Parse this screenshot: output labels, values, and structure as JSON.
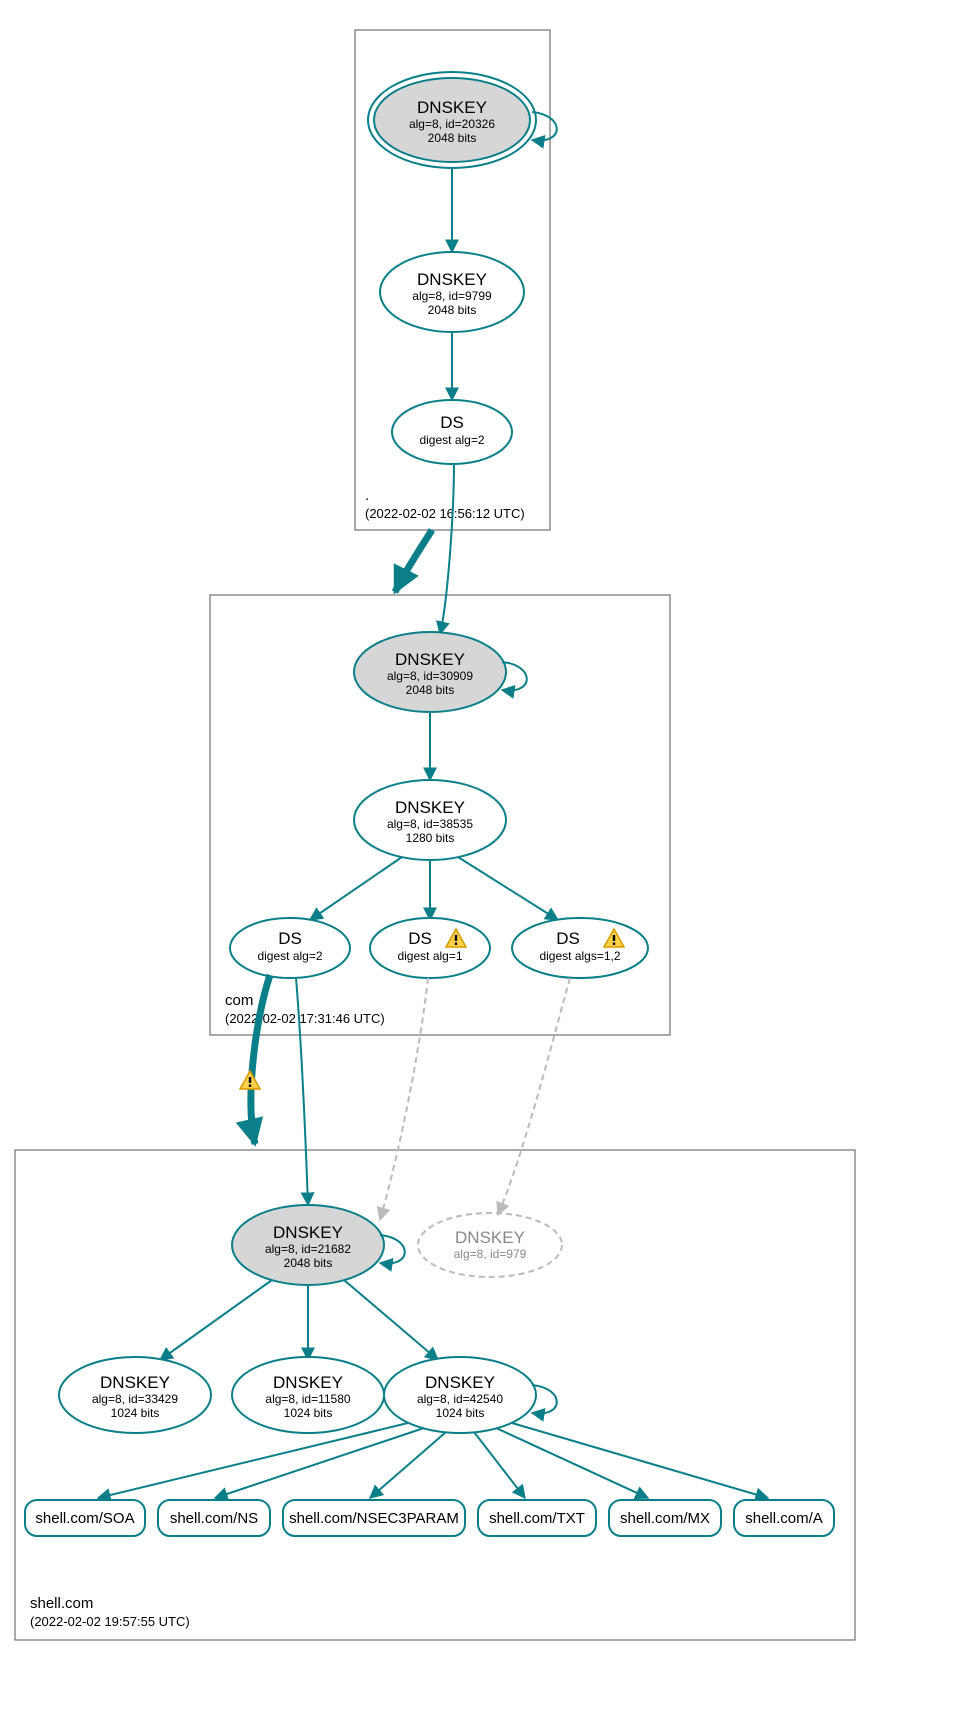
{
  "zones": {
    "root": {
      "name": ".",
      "timestamp": "(2022-02-02 16:56:12 UTC)"
    },
    "com": {
      "name": "com",
      "timestamp": "(2022-02-02 17:31:46 UTC)"
    },
    "shell": {
      "name": "shell.com",
      "timestamp": "(2022-02-02 19:57:55 UTC)"
    }
  },
  "nodes": {
    "root_ksk": {
      "title": "DNSKEY",
      "line2": "alg=8, id=20326",
      "line3": "2048 bits"
    },
    "root_zsk": {
      "title": "DNSKEY",
      "line2": "alg=8, id=9799",
      "line3": "2048 bits"
    },
    "root_ds": {
      "title": "DS",
      "line2": "digest alg=2"
    },
    "com_ksk": {
      "title": "DNSKEY",
      "line2": "alg=8, id=30909",
      "line3": "2048 bits"
    },
    "com_zsk": {
      "title": "DNSKEY",
      "line2": "alg=8, id=38535",
      "line3": "1280 bits"
    },
    "com_ds1": {
      "title": "DS",
      "line2": "digest alg=2"
    },
    "com_ds2": {
      "title": "DS",
      "line2": "digest alg=1"
    },
    "com_ds3": {
      "title": "DS",
      "line2": "digest algs=1,2"
    },
    "shell_ksk": {
      "title": "DNSKEY",
      "line2": "alg=8, id=21682",
      "line3": "2048 bits"
    },
    "shell_old": {
      "title": "DNSKEY",
      "line2": "alg=8, id=979"
    },
    "shell_z1": {
      "title": "DNSKEY",
      "line2": "alg=8, id=33429",
      "line3": "1024 bits"
    },
    "shell_z2": {
      "title": "DNSKEY",
      "line2": "alg=8, id=11580",
      "line3": "1024 bits"
    },
    "shell_z3": {
      "title": "DNSKEY",
      "line2": "alg=8, id=42540",
      "line3": "1024 bits"
    }
  },
  "rrsets": {
    "soa": "shell.com/SOA",
    "ns": "shell.com/NS",
    "nsec3": "shell.com/NSEC3PARAM",
    "txt": "shell.com/TXT",
    "mx": "shell.com/MX",
    "a": "shell.com/A"
  }
}
